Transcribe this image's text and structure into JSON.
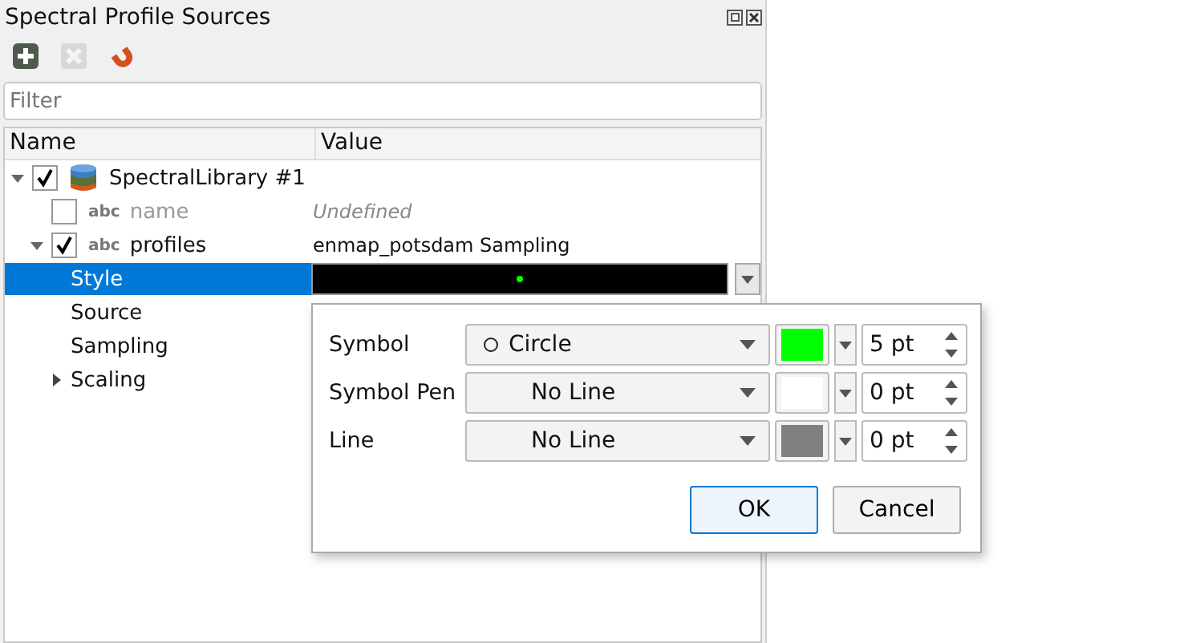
{
  "panel": {
    "title": "Spectral Profile Sources"
  },
  "filter": {
    "placeholder": "Filter"
  },
  "columns": [
    "Name",
    "Value"
  ],
  "tree": [
    {
      "label": "SpectralLibrary #1",
      "kind": "library",
      "checked": true,
      "expanded": true,
      "selected": false,
      "children": [
        {
          "label": "name",
          "kind": "field",
          "type_label": "abc",
          "checked": false,
          "selected": false,
          "value": "Undefined"
        },
        {
          "label": "profiles",
          "kind": "field",
          "type_label": "abc",
          "checked": true,
          "expanded": true,
          "selected": false,
          "value": "enmap_potsdam Sampling",
          "children": [
            {
              "label": "Style",
              "kind": "style",
              "selected": true
            },
            {
              "label": "Source",
              "kind": "plain",
              "selected": false
            },
            {
              "label": "Sampling",
              "kind": "plain",
              "selected": false
            },
            {
              "label": "Scaling",
              "kind": "plain",
              "expanded": false,
              "selected": false
            }
          ]
        }
      ]
    }
  ],
  "style_editor": {
    "rows": [
      {
        "label": "Symbol",
        "kind": "symbol",
        "value": "Circle",
        "color": "#00ff00",
        "size": "5 pt"
      },
      {
        "label": "Symbol Pen",
        "kind": "line",
        "value": "No Line",
        "color": "#ffffff",
        "size": "0 pt"
      },
      {
        "label": "Line",
        "kind": "line",
        "value": "No Line",
        "color": "#808080",
        "size": "0 pt"
      }
    ],
    "buttons": [
      "OK",
      "Cancel"
    ]
  }
}
